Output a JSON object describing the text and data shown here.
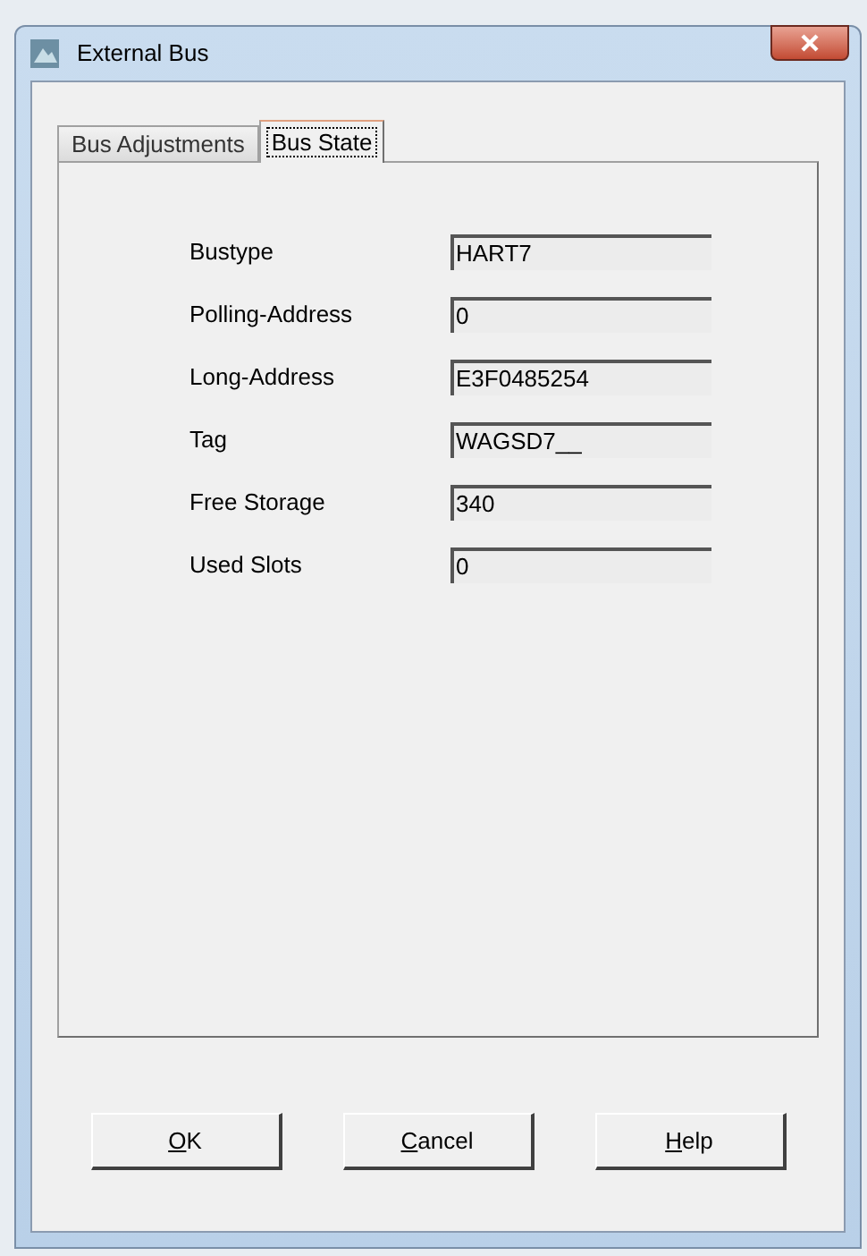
{
  "window": {
    "title": "External Bus"
  },
  "tabs": [
    {
      "label": "Bus Adjustments",
      "selected": false
    },
    {
      "label": "Bus State",
      "selected": true
    }
  ],
  "fields": [
    {
      "label": "Bustype",
      "value": "HART7"
    },
    {
      "label": "Polling-Address",
      "value": "0"
    },
    {
      "label": "Long-Address",
      "value": "E3F0485254"
    },
    {
      "label": "Tag",
      "value": "WAGSD7__"
    },
    {
      "label": "Free Storage",
      "value": "340"
    },
    {
      "label": "Used Slots",
      "value": "0"
    }
  ],
  "buttons": [
    "OK",
    "Cancel",
    "Help"
  ]
}
